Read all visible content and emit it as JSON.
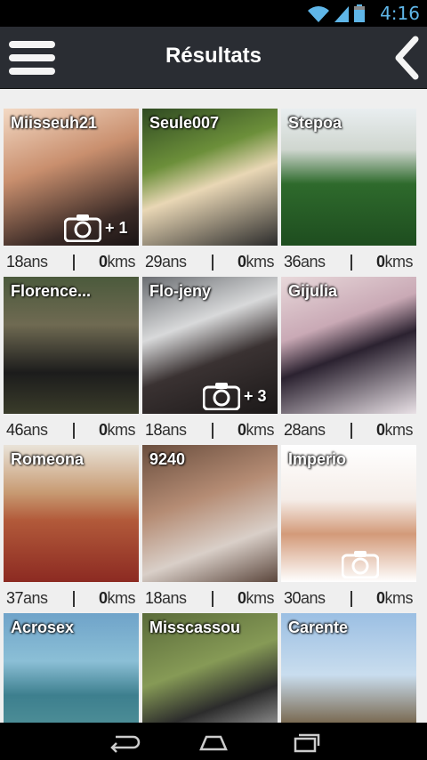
{
  "status_bar": {
    "time": "4:16",
    "icons": [
      "wifi-icon",
      "signal-icon",
      "battery-icon"
    ]
  },
  "app_bar": {
    "title": "Résultats",
    "menu_icon": "hamburger-icon",
    "back_icon": "chevron-left-icon"
  },
  "results": [
    {
      "name": "Miisseuh21",
      "age": "18",
      "age_unit": "ans",
      "distance": "0",
      "distance_unit": "kms",
      "photo_count": "+ 1"
    },
    {
      "name": "Seule007",
      "age": "29",
      "age_unit": "ans",
      "distance": "0",
      "distance_unit": "kms",
      "photo_count": ""
    },
    {
      "name": "Stepoa",
      "age": "36",
      "age_unit": "ans",
      "distance": "0",
      "distance_unit": "kms",
      "photo_count": ""
    },
    {
      "name": "Florence...",
      "age": "46",
      "age_unit": "ans",
      "distance": "0",
      "distance_unit": "kms",
      "photo_count": ""
    },
    {
      "name": "Flo-jeny",
      "age": "18",
      "age_unit": "ans",
      "distance": "0",
      "distance_unit": "kms",
      "photo_count": "+ 3"
    },
    {
      "name": "Gijulia",
      "age": "28",
      "age_unit": "ans",
      "distance": "0",
      "distance_unit": "kms",
      "photo_count": ""
    },
    {
      "name": "Romeona",
      "age": "37",
      "age_unit": "ans",
      "distance": "0",
      "distance_unit": "kms",
      "photo_count": ""
    },
    {
      "name": "9240",
      "age": "18",
      "age_unit": "ans",
      "distance": "0",
      "distance_unit": "kms",
      "photo_count": ""
    },
    {
      "name": "Imperio",
      "age": "30",
      "age_unit": "ans",
      "distance": "0",
      "distance_unit": "kms",
      "photo_count": ""
    },
    {
      "name": "Acrosex",
      "age": "",
      "age_unit": "",
      "distance": "",
      "distance_unit": "",
      "photo_count": ""
    },
    {
      "name": "Misscassou",
      "age": "",
      "age_unit": "",
      "distance": "",
      "distance_unit": "",
      "photo_count": ""
    },
    {
      "name": "Carente",
      "age": "",
      "age_unit": "",
      "distance": "",
      "distance_unit": "",
      "photo_count": ""
    }
  ],
  "nav_bar": {
    "icons": [
      "back-nav-icon",
      "home-nav-icon",
      "recents-nav-icon"
    ]
  },
  "colors": {
    "app_bar": "#2a2d33",
    "status_time": "#5fb6e8",
    "background": "#efefef"
  }
}
